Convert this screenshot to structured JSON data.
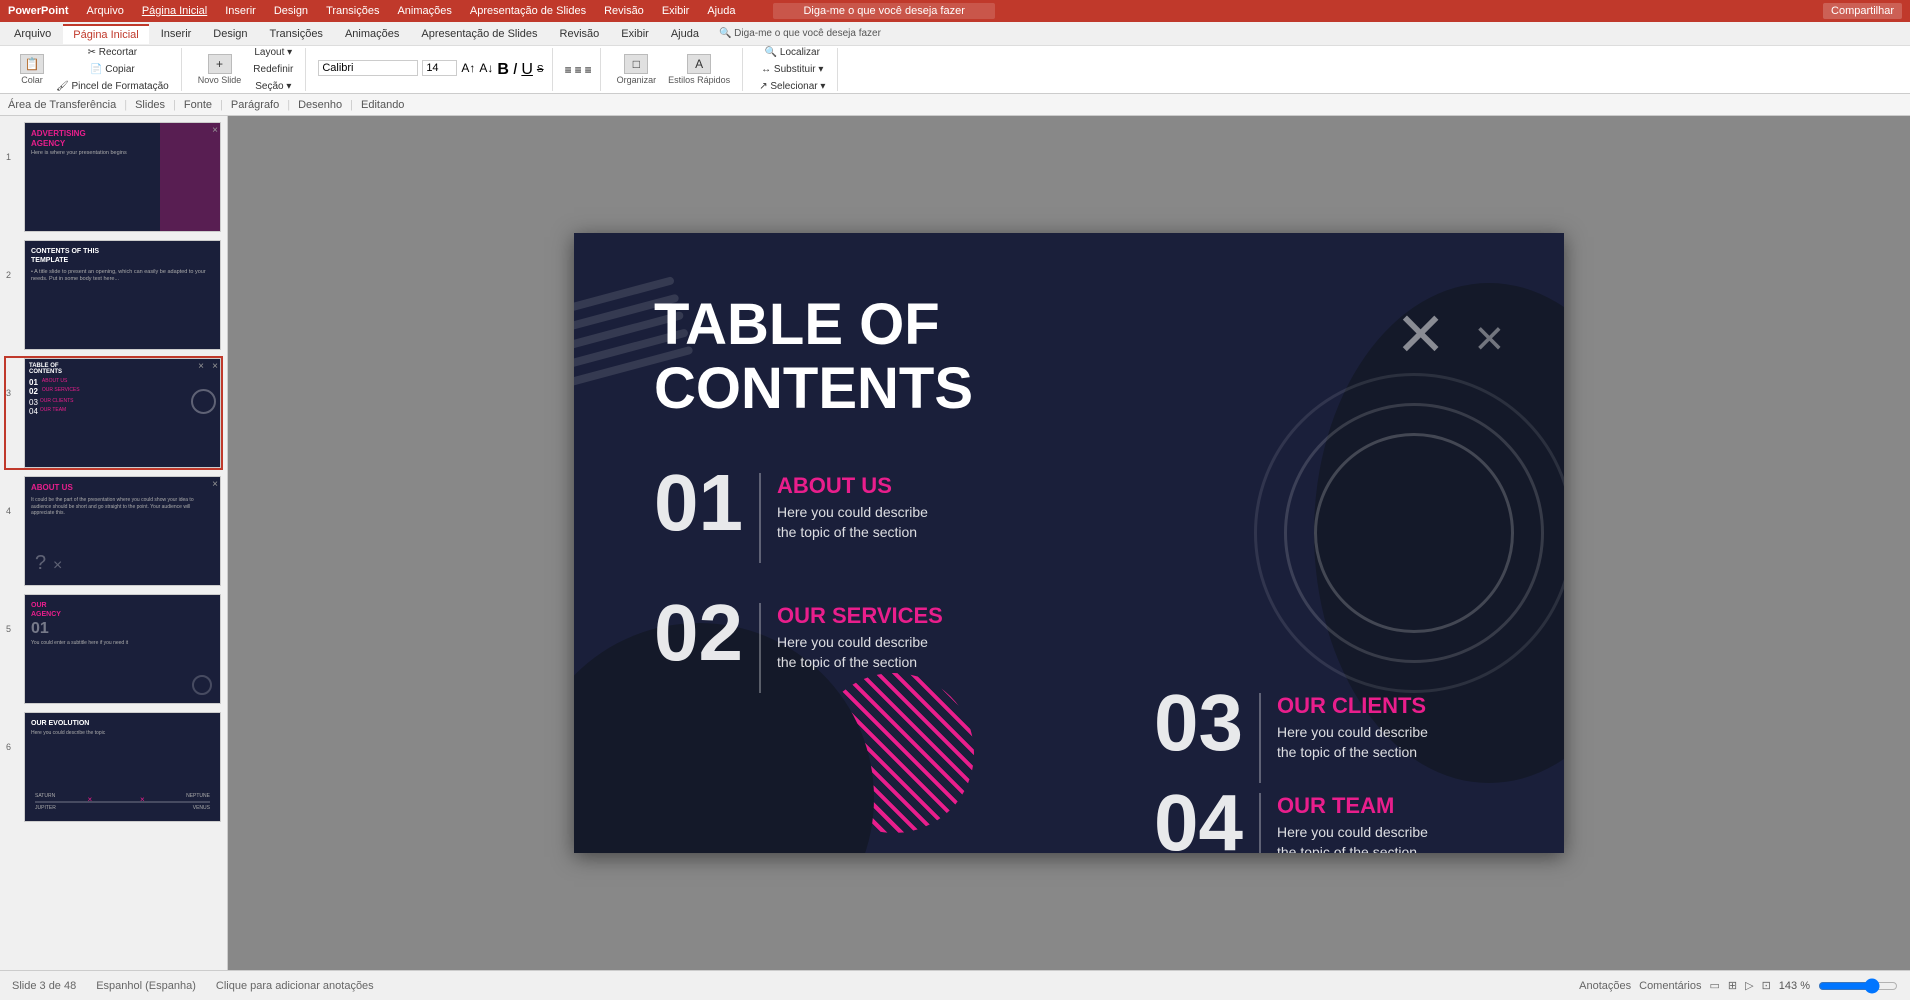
{
  "app": {
    "title": "PowerPoint",
    "menu_items": [
      "Arquivo",
      "Página Inicial",
      "Inserir",
      "Design",
      "Transições",
      "Animações",
      "Apresentação de Slides",
      "Revisão",
      "Exibir",
      "Ajuda"
    ],
    "search_placeholder": "Diga-me o que você deseja fazer",
    "share_label": "Compartilhar"
  },
  "ribbon": {
    "tabs": [
      "Arquivo",
      "Página Inicial",
      "Inserir",
      "Design",
      "Transições",
      "Animações",
      "Apresentação de Slides",
      "Revisão",
      "Exibir",
      "Ajuda"
    ],
    "active_tab": "Página Inicial",
    "groups": [
      "Área de Transferência",
      "Slides",
      "Fonte",
      "Parágrafo",
      "Desenho",
      "Editando"
    ]
  },
  "status_bar": {
    "slide_info": "Slide 3 de 48",
    "language": "Espanhol (Espanha)",
    "notes_label": "Anotações",
    "comments_label": "Comentários",
    "zoom": "143 %"
  },
  "notes_placeholder": "Clique para adicionar anotações",
  "slides": [
    {
      "number": "1",
      "title": "ADVERTISING AGENCY",
      "subtitle": "Here is where your presentation begins",
      "type": "cover"
    },
    {
      "number": "2",
      "title": "CONTENTS OF THIS TEMPLATE",
      "type": "contents"
    },
    {
      "number": "3",
      "title": "TABLE OF CONTENTS",
      "type": "toc",
      "active": true
    },
    {
      "number": "4",
      "title": "ABOUT US",
      "type": "about"
    },
    {
      "number": "5",
      "title": "OUR AGENCY",
      "subtitle": "01",
      "type": "agency"
    },
    {
      "number": "6",
      "title": "OUR EVOLUTION",
      "type": "evolution"
    }
  ],
  "slide": {
    "title_line1": "TABLE OF",
    "title_line2": "CONTENTS",
    "items": [
      {
        "number": "01",
        "title": "ABOUT US",
        "description_line1": "Here you could describe",
        "description_line2": "the topic of the section"
      },
      {
        "number": "02",
        "title": "OUR SERVICES",
        "description_line1": "Here you could describe",
        "description_line2": "the topic of the section"
      },
      {
        "number": "03",
        "title": "OUR CLIENTS",
        "description_line1": "Here you could describe",
        "description_line2": "the topic of the section"
      },
      {
        "number": "04",
        "title": "OUR TEAM",
        "description_line1": "Here you could describe",
        "description_line2": "the topic of the section"
      }
    ]
  }
}
